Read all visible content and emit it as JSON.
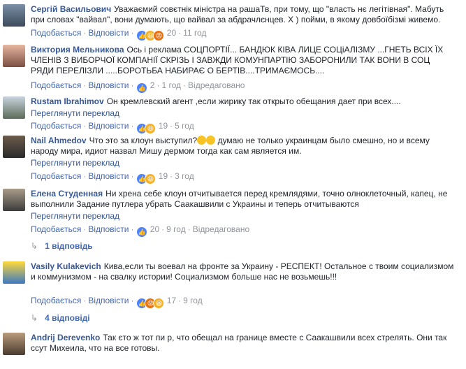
{
  "labels": {
    "like": "Подобається",
    "reply": "Відповісти",
    "dot": "·",
    "translate": "Переглянути переклад"
  },
  "comments": [
    {
      "author": "Сергій Васильович",
      "text": "Уважаємий совєтнік міністра на рашаТв, при тому, що \"власть нє легітівная\". Мабуть при словах \"вайвал\", вони думають, що вайвал за абдрачлєнцев. Х   ) пойми, в якому довбоїбізмі живемо.",
      "count": "20",
      "time": "11 год",
      "reactions": [
        "like",
        "haha",
        "angry"
      ]
    },
    {
      "author": "Виктория Мельникова",
      "text": "Ось і реклама СОЦПОРТІЇ... БАНДЮК КІВА ЛИЦЕ СОЦіАЛІЗМУ ...ГНЕТЬ ВСІХ ЇХ ЧЛЕНІВ З ВИБОРЧОЇ КОМПАНІЇ СКРІЗЬ І ЗАВЖДИ КОМУНПАРТІЮ ЗАБОРОНИЛИ ТАК ВОНИ В СОЦ РЯДИ ПЕРЕЛІЗЛИ .....БОРОТЬБА НАБИРАЄ О БЕРТІВ....ТРИМАЄМОСЬ....",
      "count": "2",
      "time": "1 год",
      "edited": "Відредаговано",
      "reactions": [
        "like"
      ]
    },
    {
      "author": "Rustam Ibrahimov",
      "text": "Он кремлевский агент ,если жирику так открыто обещания дает при всех....",
      "count": "19",
      "time": "5 год",
      "reactions": [
        "like",
        "haha"
      ]
    },
    {
      "author": "Nail Ahmedov",
      "text_a": "Что это за клоун выступил?",
      "text_b": "думаю не только украинцам было смешно, но и всему народу мира, идиот назвал Мишу дермом тогда как сам является им.",
      "count": "19",
      "time": "3 год",
      "reactions": [
        "like",
        "haha"
      ]
    },
    {
      "author": "Елена Студенная",
      "text": "Ни хрена себе клоун отчитывается перед кремлядями, точно олноклеточный, капец, не выполнили Задание путлера убрать Саакашвили с Украины и теперь отчитываются",
      "count": "20",
      "time": "9 год",
      "edited": "Відредаговано",
      "reactions": [
        "like"
      ],
      "replies": "1 відповідь"
    },
    {
      "author": "Vasily Kulakevich",
      "text": "Кива,если ты воевал на фронте за Украину - РЕСПЕКТ! Остальное с твоим социализмом и коммунизмом - на свалку истории! Социализмом больше нас не возьмешь!!!",
      "count": "17",
      "time": "9 год",
      "reactions": [
        "like",
        "angry",
        "haha"
      ],
      "replies": "4 відповіді"
    },
    {
      "author": "Andrij Derevenko",
      "text": "Так єто ж тот пи      р, что обещал на границе вместе с Саакашвили всех стрелять. Они так ссут Михеила, что на все готовы."
    }
  ]
}
